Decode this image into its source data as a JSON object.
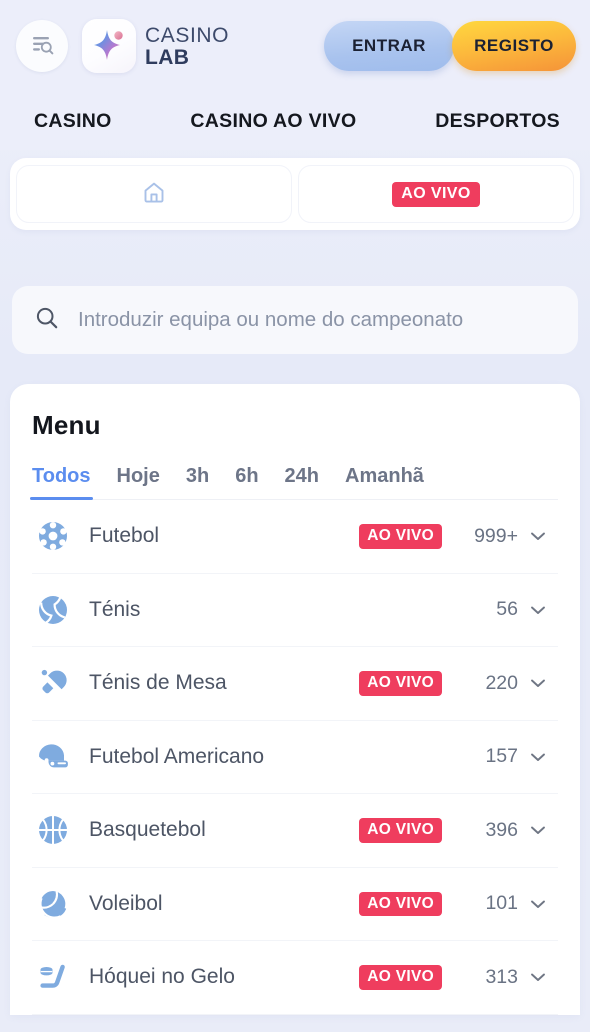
{
  "header": {
    "menu_icon": "menu-search-icon",
    "brand": {
      "logo_icon": "sparkle-star-icon",
      "line1": "CASINO",
      "line2": "LAB"
    },
    "login_label": "ENTRAR",
    "register_label": "REGISTO"
  },
  "nav": {
    "items": [
      {
        "label": "CASINO"
      },
      {
        "label": "CASINO AO VIVO"
      },
      {
        "label": "DESPORTOS"
      }
    ]
  },
  "tabbar": {
    "tabs": [
      {
        "icon": "home-icon",
        "label": ""
      },
      {
        "icon": "",
        "label": "AO VIVO"
      }
    ]
  },
  "search": {
    "icon": "search-icon",
    "placeholder": "Introduzir equipa ou nome do campeonato",
    "value": ""
  },
  "menu": {
    "title": "Menu",
    "filters": [
      {
        "label": "Todos",
        "active": true
      },
      {
        "label": "Hoje",
        "active": false
      },
      {
        "label": "3h",
        "active": false
      },
      {
        "label": "6h",
        "active": false
      },
      {
        "label": "24h",
        "active": false
      },
      {
        "label": "Amanhã",
        "active": false
      }
    ],
    "live_label": "AO VIVO",
    "sports": [
      {
        "name": "Futebol",
        "icon": "soccer-ball-icon",
        "live": true,
        "count": "999+"
      },
      {
        "name": "Ténis",
        "icon": "tennis-ball-icon",
        "live": false,
        "count": "56"
      },
      {
        "name": "Ténis de Mesa",
        "icon": "table-tennis-icon",
        "live": true,
        "count": "220"
      },
      {
        "name": "Futebol Americano",
        "icon": "football-helmet-icon",
        "live": false,
        "count": "157"
      },
      {
        "name": "Basquetebol",
        "icon": "basketball-icon",
        "live": true,
        "count": "396"
      },
      {
        "name": "Voleibol",
        "icon": "volleyball-icon",
        "live": true,
        "count": "101"
      },
      {
        "name": "Hóquei no Gelo",
        "icon": "ice-hockey-icon",
        "live": true,
        "count": "313"
      }
    ]
  },
  "colors": {
    "background": "#e9ecf8",
    "accent_blue": "#5b8def",
    "live_red": "#ef3d5e",
    "register_gradient_start": "#ffd83f",
    "register_gradient_end": "#f59338",
    "login_gradient_start": "#c4d6f5",
    "login_gradient_end": "#9fbcec",
    "sport_icon_blue": "#7fabdf",
    "text_dark": "#15181f",
    "text_muted": "#6d7588"
  }
}
